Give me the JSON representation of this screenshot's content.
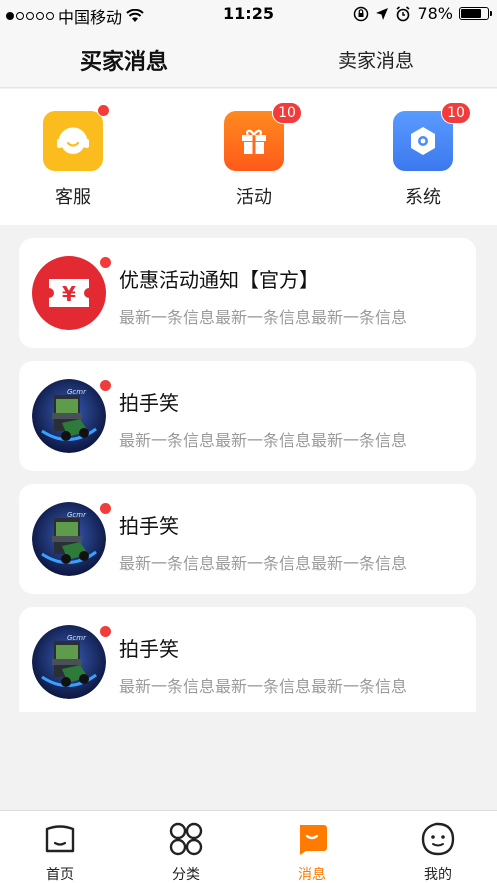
{
  "status_bar": {
    "carrier": "中国移动",
    "time": "11:25",
    "battery": "78%",
    "battery_level": 0.78
  },
  "header": {
    "tabs": [
      {
        "label": "买家消息",
        "active": true
      },
      {
        "label": "卖家消息",
        "active": false
      }
    ]
  },
  "categories": [
    {
      "label": "客服",
      "icon": "headset-icon",
      "color": "#fbbd1e",
      "badge": ""
    },
    {
      "label": "活动",
      "icon": "gift-icon",
      "color": "#ff6a1a",
      "badge": "10"
    },
    {
      "label": "系统",
      "icon": "hexagon-settings-icon",
      "color": "#4e8cf6",
      "badge": "10"
    }
  ],
  "messages": [
    {
      "title": "优惠活动通知【官方】",
      "preview": "最新一条信息最新一条信息最新一条信息",
      "avatar": "coupon-icon"
    },
    {
      "title": "拍手笑",
      "preview": "最新一条信息最新一条信息最新一条信息",
      "avatar": "arcade-machine-avatar"
    },
    {
      "title": "拍手笑",
      "preview": "最新一条信息最新一条信息最新一条信息",
      "avatar": "arcade-machine-avatar"
    },
    {
      "title": "拍手笑",
      "preview": "最新一条信息最新一条信息最新一条信息",
      "avatar": "arcade-machine-avatar"
    }
  ],
  "tabbar": [
    {
      "label": "首页",
      "icon": "home-face-icon",
      "active": false
    },
    {
      "label": "分类",
      "icon": "category-grid-icon",
      "active": false
    },
    {
      "label": "消息",
      "icon": "message-bubble-icon",
      "active": true
    },
    {
      "label": "我的",
      "icon": "profile-face-icon",
      "active": false
    }
  ],
  "colors": {
    "accent": "#ff7a00",
    "badge": "#f23b3b"
  }
}
